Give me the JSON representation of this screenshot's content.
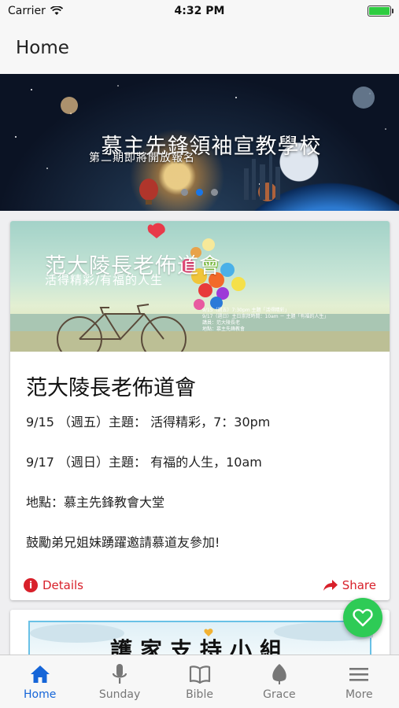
{
  "status_bar": {
    "carrier": "Carrier",
    "time": "4:32 PM"
  },
  "nav": {
    "title": "Home"
  },
  "banner": {
    "title": "慕主先鋒領袖宣教學校",
    "subtitle": "第二期即將開放報名",
    "dots_count": 3,
    "active_dot": 2
  },
  "card1": {
    "image": {
      "title": "范大陵長老佈道會",
      "subtitle": "活得精彩/有福的人生",
      "info_lines": [
        "9/15（週五）7:30pm 主題「活得精彩」",
        "9/17（週日）主日崇拜時間：10am － 主題「有福的人生」",
        "講員：范大陵長老",
        "地點：慕主先鋒教會"
      ]
    },
    "heading": "范大陵長老佈道會",
    "lines": [
      "9/15 （週五）主題： 活得精彩，7：30pm",
      "9/17 （週日）主題： 有福的人生，10am",
      "地點：慕主先鋒教會大堂",
      "鼓勵弟兄姐妹踴躍邀請慕道友參加!"
    ],
    "details_label": "Details",
    "share_label": "Share"
  },
  "card2": {
    "image_title": "護家支持小組"
  },
  "tabs": [
    {
      "label": "Home",
      "icon": "home-icon",
      "active": true
    },
    {
      "label": "Sunday",
      "icon": "microphone-icon",
      "active": false
    },
    {
      "label": "Bible",
      "icon": "book-icon",
      "active": false
    },
    {
      "label": "Grace",
      "icon": "leaf-icon",
      "active": false
    },
    {
      "label": "More",
      "icon": "menu-icon",
      "active": false
    }
  ],
  "colors": {
    "accent_blue": "#1565d8",
    "action_red": "#d8202a",
    "fab_green": "#2ecb56"
  }
}
